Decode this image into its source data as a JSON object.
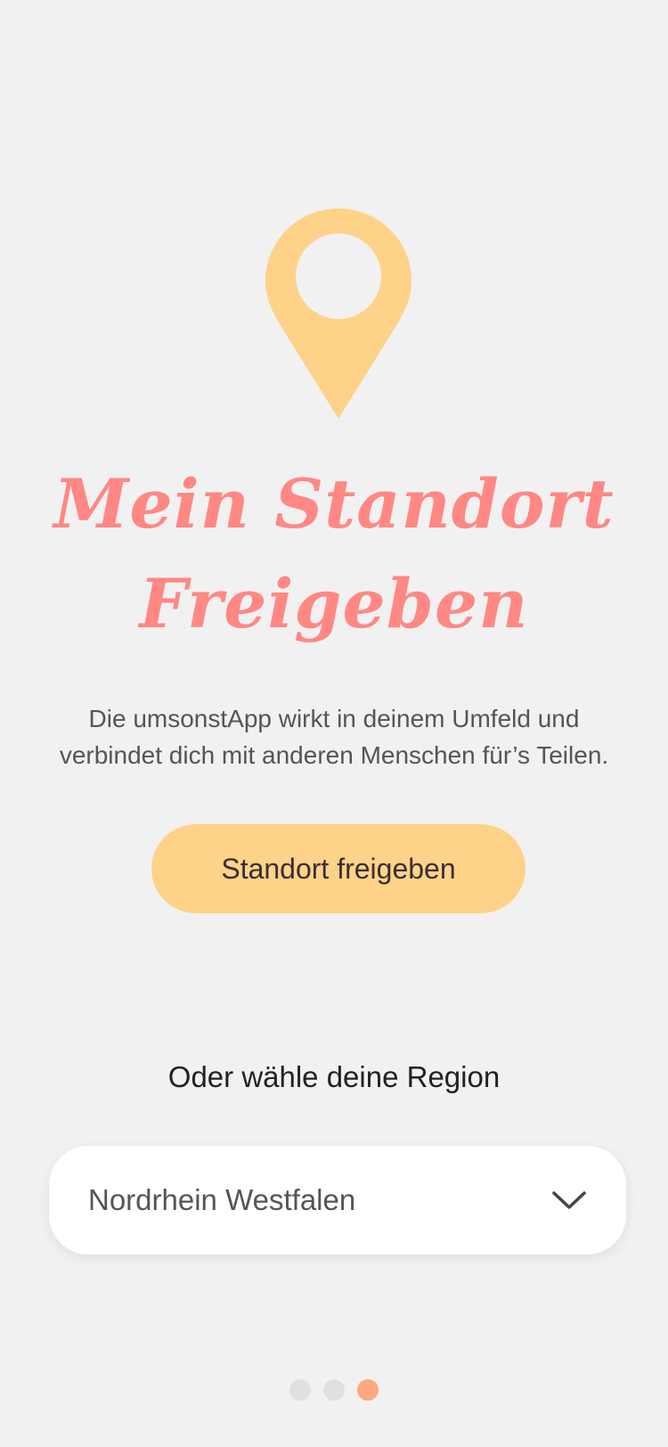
{
  "colors": {
    "background": "#f2f1f1",
    "pin": "#ffd28a",
    "title": "#ff8884",
    "button": "#ffd28a",
    "dot_active": "#ffa77e",
    "dot_inactive": "#e0e0e0"
  },
  "hero": {
    "icon": "location-pin-icon",
    "title_line1": "Mein Standort",
    "title_line2": "Freigeben"
  },
  "description": {
    "line1": "Die umsonstApp wirkt in deinem Umfeld und",
    "line2": "verbindet dich mit anderen Menschen für’s Teilen."
  },
  "share_button": {
    "label": "Standort freigeben"
  },
  "region": {
    "label": "Oder wähle deine Region",
    "selected": "Nordrhein Westfalen",
    "icon": "chevron-down-icon"
  },
  "pagination": {
    "total": 3,
    "active_index": 2
  }
}
